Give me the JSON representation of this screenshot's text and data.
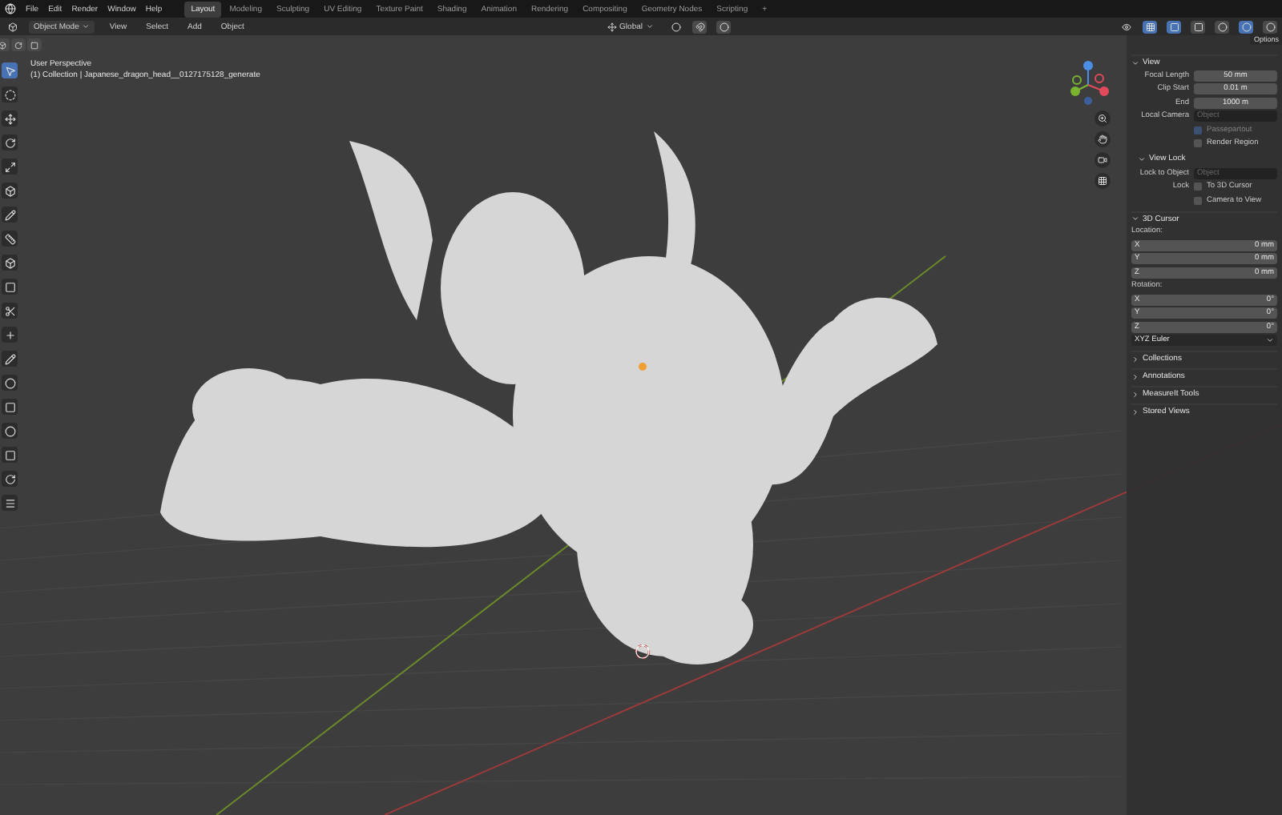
{
  "menu": [
    "File",
    "Edit",
    "Render",
    "Window",
    "Help"
  ],
  "workspaces": [
    {
      "label": "Layout",
      "selected": true
    },
    {
      "label": "Modeling",
      "selected": false
    },
    {
      "label": "Sculpting",
      "selected": false
    },
    {
      "label": "UV Editing",
      "selected": false
    },
    {
      "label": "Texture Paint",
      "selected": false
    },
    {
      "label": "Shading",
      "selected": false
    },
    {
      "label": "Animation",
      "selected": false
    },
    {
      "label": "Rendering",
      "selected": false
    },
    {
      "label": "Compositing",
      "selected": false
    },
    {
      "label": "Geometry Nodes",
      "selected": false
    },
    {
      "label": "Scripting",
      "selected": false
    }
  ],
  "add_workspace": "+",
  "header": {
    "mode": "Object Mode",
    "menus": [
      "View",
      "Select",
      "Add",
      "Object"
    ],
    "orientation": "Global"
  },
  "viewport": {
    "title": "User Perspective",
    "subtitle": "(1) Collection | Japanese_dragon_head__0127175128_generate"
  },
  "sidebar": {
    "options_tab": "Options",
    "panels": [
      {
        "title": "View",
        "expanded": true,
        "rows": [
          {
            "kind": "field",
            "label": "Focal Length",
            "value": "50 mm"
          },
          {
            "kind": "field",
            "label": "Clip Start",
            "value": "0.01 m"
          },
          {
            "kind": "field",
            "label": "End",
            "value": "1000 m"
          },
          {
            "kind": "object",
            "label": "Local Camera",
            "placeholder": "Object"
          },
          {
            "kind": "check",
            "label": "Passepartout",
            "checked": true,
            "disabled": true
          },
          {
            "kind": "check",
            "label": "Render Region",
            "checked": false,
            "disabled": false
          },
          {
            "kind": "subpanel",
            "label": "View Lock",
            "expanded": true
          },
          {
            "kind": "object",
            "label": "Lock to Object",
            "placeholder": "Object"
          },
          {
            "kind": "check",
            "prefix": "Lock",
            "label": "To 3D Cursor",
            "checked": false,
            "disabled": false
          },
          {
            "kind": "check",
            "label": "Camera to View",
            "checked": false,
            "disabled": false
          }
        ]
      },
      {
        "title": "3D Cursor",
        "expanded": true,
        "rows": [
          {
            "kind": "heading",
            "label": "Location:"
          },
          {
            "kind": "axis",
            "label": "X",
            "value": "0 mm"
          },
          {
            "kind": "axis",
            "label": "Y",
            "value": "0 mm"
          },
          {
            "kind": "axis",
            "label": "Z",
            "value": "0 mm"
          },
          {
            "kind": "heading",
            "label": "Rotation:"
          },
          {
            "kind": "axis",
            "label": "X",
            "value": "0°"
          },
          {
            "kind": "axis",
            "label": "Y",
            "value": "0°"
          },
          {
            "kind": "axis",
            "label": "Z",
            "value": "0°"
          },
          {
            "kind": "select",
            "value": "XYZ Euler"
          }
        ]
      },
      {
        "title": "Collections",
        "expanded": false
      },
      {
        "title": "Annotations",
        "expanded": false
      },
      {
        "title": "MeasureIt Tools",
        "expanded": false
      },
      {
        "title": "Stored Views",
        "expanded": false
      }
    ]
  }
}
